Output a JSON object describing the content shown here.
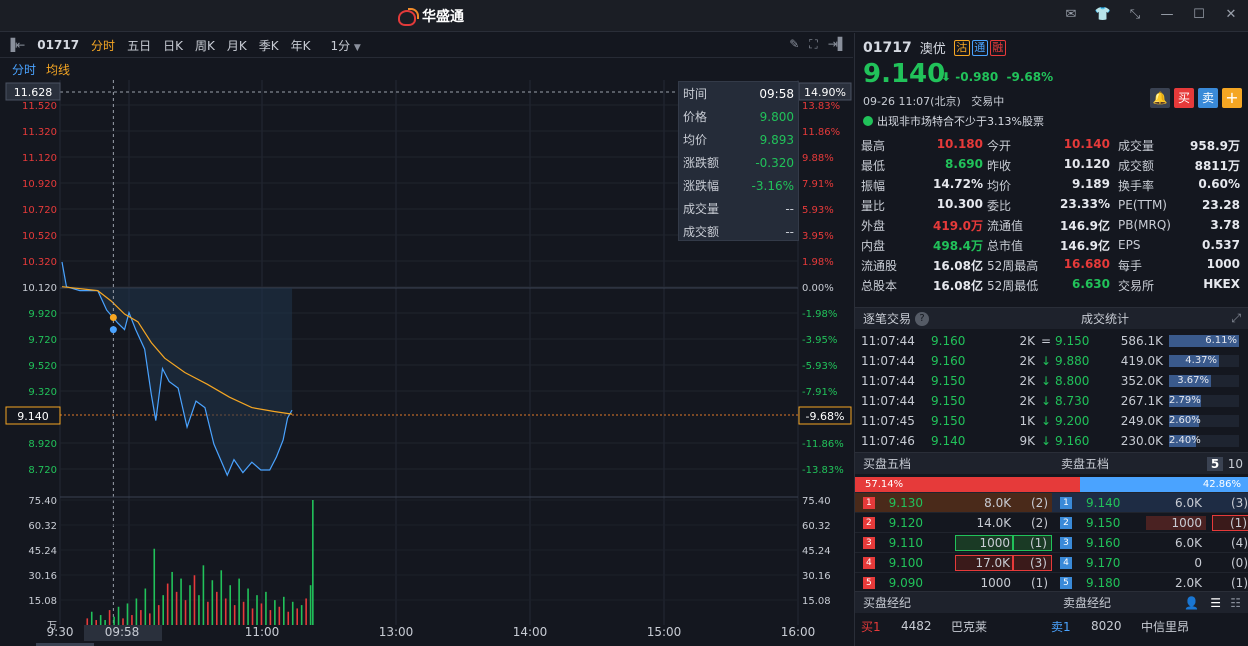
{
  "app": {
    "brand": "华盛通"
  },
  "window_icons": [
    "mail-icon",
    "shirt-icon",
    "shrink-icon",
    "minimize-icon",
    "maximize-icon",
    "close-icon"
  ],
  "toolbar": {
    "code": "01717",
    "periods": [
      "分时",
      "五日",
      "日K",
      "周K",
      "月K",
      "季K",
      "年K"
    ],
    "active_period": "分时",
    "interval": "1分"
  },
  "subbar": {
    "tab1": "分时",
    "tab2": "均线"
  },
  "colors": {
    "up": "#e63a3a",
    "down": "#21c25a",
    "price_line": "#4aa3ff",
    "avg_line": "#f5a623",
    "accent": "#f5a623"
  },
  "chart_data": {
    "type": "line",
    "price_axis": {
      "ticks": [
        "11.628",
        "11.520",
        "11.320",
        "11.120",
        "10.920",
        "10.720",
        "10.520",
        "10.320",
        "10.120",
        "9.920",
        "9.720",
        "9.520",
        "9.320",
        "9.140",
        "8.920",
        "8.720"
      ],
      "pct_ticks": [
        "14.90%",
        "13.83%",
        "11.86%",
        "9.88%",
        "7.91%",
        "5.93%",
        "3.95%",
        "1.98%",
        "0.00%",
        "-1.98%",
        "-3.95%",
        "-5.93%",
        "-7.91%",
        "-9.68%",
        "-11.86%",
        "-13.83%"
      ],
      "range": [
        8.61,
        11.628
      ],
      "prev_close": 10.12
    },
    "time_axis": [
      "9:30",
      "09:58",
      "11:00",
      "13:00",
      "14:00",
      "15:00",
      "16:00"
    ],
    "vol_axis": [
      "75.40",
      "60.32",
      "45.24",
      "30.16",
      "15.08",
      "万"
    ],
    "price": [
      [
        0,
        10.32
      ],
      [
        2,
        10.13
      ],
      [
        8,
        10.1
      ],
      [
        16,
        10.1
      ],
      [
        20,
        9.95
      ],
      [
        25,
        9.85
      ],
      [
        28,
        9.8
      ],
      [
        30,
        9.93
      ],
      [
        33,
        9.8
      ],
      [
        37,
        9.65
      ],
      [
        40,
        9.3
      ],
      [
        42,
        9.1
      ],
      [
        45,
        9.5
      ],
      [
        48,
        9.4
      ],
      [
        52,
        9.35
      ],
      [
        56,
        9.05
      ],
      [
        60,
        9.25
      ],
      [
        64,
        9.2
      ],
      [
        68,
        8.92
      ],
      [
        71,
        8.8
      ],
      [
        74,
        8.68
      ],
      [
        77,
        8.8
      ],
      [
        81,
        8.7
      ],
      [
        85,
        8.78
      ],
      [
        89,
        8.72
      ],
      [
        93,
        8.72
      ],
      [
        96,
        8.82
      ],
      [
        99,
        8.95
      ],
      [
        101,
        9.12
      ],
      [
        103,
        9.18
      ]
    ],
    "avg": [
      [
        0,
        10.13
      ],
      [
        16,
        10.1
      ],
      [
        22,
        10.02
      ],
      [
        28,
        9.92
      ],
      [
        34,
        9.86
      ],
      [
        40,
        9.7
      ],
      [
        46,
        9.58
      ],
      [
        55,
        9.47
      ],
      [
        65,
        9.38
      ],
      [
        75,
        9.28
      ],
      [
        85,
        9.2
      ],
      [
        95,
        9.17
      ],
      [
        103,
        9.15
      ]
    ],
    "volume_max": 75.4,
    "volume": [
      [
        2,
        4,
        "r"
      ],
      [
        4,
        8,
        "g"
      ],
      [
        6,
        3,
        "r"
      ],
      [
        8,
        6,
        "g"
      ],
      [
        10,
        3,
        "g"
      ],
      [
        12,
        9,
        "r"
      ],
      [
        14,
        5,
        "g"
      ],
      [
        16,
        11,
        "g"
      ],
      [
        18,
        4,
        "r"
      ],
      [
        20,
        13,
        "g"
      ],
      [
        22,
        6,
        "r"
      ],
      [
        24,
        16,
        "g"
      ],
      [
        26,
        9,
        "r"
      ],
      [
        28,
        22,
        "g"
      ],
      [
        30,
        7,
        "r"
      ],
      [
        32,
        46,
        "g"
      ],
      [
        34,
        12,
        "r"
      ],
      [
        36,
        18,
        "g"
      ],
      [
        38,
        25,
        "r"
      ],
      [
        40,
        32,
        "g"
      ],
      [
        42,
        20,
        "r"
      ],
      [
        44,
        28,
        "g"
      ],
      [
        46,
        15,
        "r"
      ],
      [
        48,
        24,
        "g"
      ],
      [
        50,
        30,
        "r"
      ],
      [
        52,
        18,
        "g"
      ],
      [
        54,
        36,
        "g"
      ],
      [
        56,
        14,
        "r"
      ],
      [
        58,
        27,
        "g"
      ],
      [
        60,
        20,
        "r"
      ],
      [
        62,
        33,
        "g"
      ],
      [
        64,
        16,
        "r"
      ],
      [
        66,
        24,
        "g"
      ],
      [
        68,
        12,
        "r"
      ],
      [
        70,
        28,
        "g"
      ],
      [
        72,
        14,
        "r"
      ],
      [
        74,
        22,
        "g"
      ],
      [
        76,
        10,
        "r"
      ],
      [
        78,
        18,
        "g"
      ],
      [
        80,
        13,
        "r"
      ],
      [
        82,
        20,
        "g"
      ],
      [
        84,
        9,
        "r"
      ],
      [
        86,
        15,
        "g"
      ],
      [
        88,
        11,
        "r"
      ],
      [
        90,
        17,
        "g"
      ],
      [
        92,
        8,
        "r"
      ],
      [
        94,
        14,
        "g"
      ],
      [
        96,
        10,
        "r"
      ],
      [
        98,
        12,
        "g"
      ],
      [
        100,
        16,
        "r"
      ],
      [
        102,
        24,
        "g"
      ],
      [
        103,
        75.4,
        "g"
      ]
    ],
    "crosshair_time_index": 23,
    "current_price_label": "9.140",
    "current_pct_label": "-9.68%"
  },
  "tooltip": {
    "rows": [
      {
        "k": "时间",
        "v": "09:58"
      },
      {
        "k": "价格",
        "v": "9.800"
      },
      {
        "k": "均价",
        "v": "9.893"
      },
      {
        "k": "涨跌额",
        "v": "-0.320"
      },
      {
        "k": "涨跌幅",
        "v": "-3.16%"
      },
      {
        "k": "成交量",
        "v": "--"
      },
      {
        "k": "成交额",
        "v": "--"
      }
    ]
  },
  "quote": {
    "code": "01717",
    "name": "澳优",
    "badges": [
      "沽",
      "通",
      "融"
    ],
    "price": "9.140",
    "change": "-0.980",
    "change_pct": "-9.68%",
    "time": "09-26 11:07(北京)",
    "status": "交易中",
    "notice": "出现非市场特合不少于3.13%股票",
    "actions": [
      "bell-icon",
      "buy",
      "sell",
      "add"
    ],
    "buy_label": "买",
    "sell_label": "卖",
    "add_label": "+"
  },
  "stats": [
    [
      [
        "最高",
        "10.180",
        "up"
      ],
      [
        "今开",
        "10.140",
        "up"
      ],
      [
        "成交量",
        "958.9万",
        ""
      ]
    ],
    [
      [
        "最低",
        "8.690",
        "down"
      ],
      [
        "昨收",
        "10.120",
        ""
      ],
      [
        "成交额",
        "8811万",
        ""
      ]
    ],
    [
      [
        "振幅",
        "14.72%",
        ""
      ],
      [
        "均价",
        "9.189",
        ""
      ],
      [
        "换手率",
        "0.60%",
        ""
      ]
    ],
    [
      [
        "量比",
        "10.300",
        ""
      ],
      [
        "委比",
        "23.33%",
        ""
      ],
      [
        "PE(TTM)",
        "23.28",
        ""
      ]
    ],
    [
      [
        "外盘",
        "419.0万",
        "up"
      ],
      [
        "流通值",
        "146.9亿",
        ""
      ],
      [
        "PB(MRQ)",
        "3.78",
        ""
      ]
    ],
    [
      [
        "内盘",
        "498.4万",
        "down"
      ],
      [
        "总市值",
        "146.9亿",
        ""
      ],
      [
        "EPS",
        "0.537",
        ""
      ]
    ],
    [
      [
        "流通股",
        "16.08亿",
        ""
      ],
      [
        "52周最高",
        "16.680",
        "up"
      ],
      [
        "每手",
        "1000",
        ""
      ]
    ],
    [
      [
        "总股本",
        "16.08亿",
        ""
      ],
      [
        "52周最低",
        "6.630",
        "down"
      ],
      [
        "交易所",
        "HKEX",
        ""
      ]
    ]
  ],
  "ticks_header": {
    "left": "逐笔交易",
    "right": "成交统计"
  },
  "ticks": [
    [
      "11:07:44",
      "9.160",
      "2K",
      "="
    ],
    [
      "11:07:44",
      "9.160",
      "2K",
      "↓"
    ],
    [
      "11:07:44",
      "9.150",
      "2K",
      "↓"
    ],
    [
      "11:07:44",
      "9.150",
      "2K",
      "↓"
    ],
    [
      "11:07:45",
      "9.150",
      "1K",
      "↓"
    ],
    [
      "11:07:46",
      "9.140",
      "9K",
      "↓"
    ]
  ],
  "vol_stats": [
    [
      "9.150",
      "586.1K",
      "6.11%",
      6.11
    ],
    [
      "9.880",
      "419.0K",
      "4.37%",
      4.37
    ],
    [
      "8.800",
      "352.0K",
      "3.67%",
      3.67
    ],
    [
      "8.730",
      "267.1K",
      "2.79%",
      2.79
    ],
    [
      "9.200",
      "249.0K",
      "2.60%",
      2.6
    ],
    [
      "9.160",
      "230.0K",
      "2.40%",
      2.4
    ]
  ],
  "orderbook": {
    "bid_title": "买盘五档",
    "ask_title": "卖盘五档",
    "levels_a": "5",
    "levels_b": "10",
    "bid_pct": "57.14%",
    "ask_pct": "42.86%",
    "bid_ratio": 57.14,
    "bids": [
      [
        "1",
        "9.130",
        "8.0K",
        "(2)"
      ],
      [
        "2",
        "9.120",
        "14.0K",
        "(2)"
      ],
      [
        "3",
        "9.110",
        "1000",
        "(1)"
      ],
      [
        "4",
        "9.100",
        "17.0K",
        "(3)"
      ],
      [
        "5",
        "9.090",
        "1000",
        "(1)"
      ]
    ],
    "asks": [
      [
        "1",
        "9.140",
        "6.0K",
        "(3)"
      ],
      [
        "2",
        "9.150",
        "1000",
        "(1)"
      ],
      [
        "3",
        "9.160",
        "6.0K",
        "(4)"
      ],
      [
        "4",
        "9.170",
        "0",
        "(0)"
      ],
      [
        "5",
        "9.180",
        "2.0K",
        "(1)"
      ]
    ]
  },
  "brokers": {
    "bid_title": "买盘经纪",
    "ask_title": "卖盘经纪",
    "bid_row": [
      "买1",
      "4482",
      "巴克莱"
    ],
    "ask_row": [
      "卖1",
      "8020",
      "中信里昂"
    ]
  }
}
